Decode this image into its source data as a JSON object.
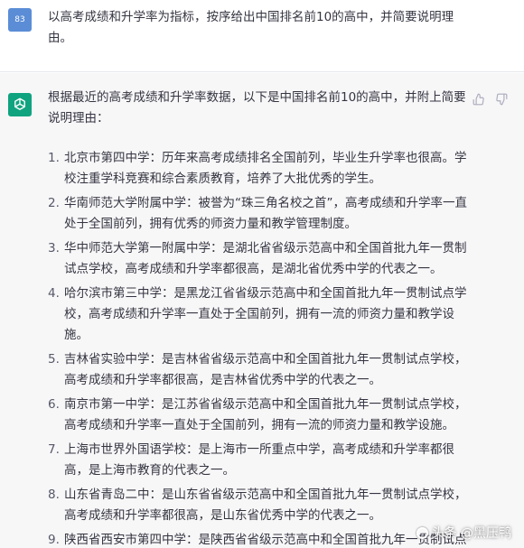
{
  "user": {
    "avatar_text": "83",
    "message": "以高考成绩和升学率为指标，按序给出中国排名前10的高中，并简要说明理由。"
  },
  "assistant": {
    "intro": "根据最近的高考成绩和升学率数据，以下是中国排名前10的高中，并附上简要说明理由：",
    "items": [
      {
        "num": "1.",
        "text": "北京市第四中学：历年来高考成绩排名全国前列，毕业生升学率也很高。学校注重学科竞赛和综合素质教育，培养了大批优秀的学生。"
      },
      {
        "num": "2.",
        "text": "华南师范大学附属中学：被誉为“珠三角名校之首”，高考成绩和升学率一直处于全国前列，拥有优秀的师资力量和教学管理制度。"
      },
      {
        "num": "3.",
        "text": "华中师范大学第一附属中学：是湖北省省级示范高中和全国首批九年一贯制试点学校，高考成绩和升学率都很高，是湖北省优秀中学的代表之一。"
      },
      {
        "num": "4.",
        "text": "哈尔滨市第三中学：是黑龙江省省级示范高中和全国首批九年一贯制试点学校，高考成绩和升学率一直处于全国前列，拥有一流的师资力量和教学设施。"
      },
      {
        "num": "5.",
        "text": "吉林省实验中学：是吉林省省级示范高中和全国首批九年一贯制试点学校，高考成绩和升学率都很高，是吉林省优秀中学的代表之一。"
      },
      {
        "num": "6.",
        "text": "南京市第一中学：是江苏省省级示范高中和全国首批九年一贯制试点学校，高考成绩和升学率一直处于全国前列，拥有一流的师资力量和教学设施。"
      },
      {
        "num": "7.",
        "text": "上海市世界外国语学校：是上海市一所重点中学，高考成绩和升学率都很高，是上海市教育的代表之一。"
      },
      {
        "num": "8.",
        "text": "山东省青岛二中：是山东省省级示范高中和全国首批九年一贯制试点学校，高考成绩和升学率都很高，是山东省优秀中学的代表之一。"
      },
      {
        "num": "9.",
        "text": "陕西省西安市第四中学：是陕西省省级示范高中和全国首批九年一贯制试点学校，高考成绩和升学率一直处于全国前列，培养了大批优秀的学生。"
      }
    ]
  },
  "watermark": {
    "text": "头条 @黑压鸭"
  },
  "colors": {
    "user_avatar": "#5b8dd6",
    "bot_avatar": "#10a37f",
    "bot_background": "#f7f7f8",
    "text": "#343541"
  },
  "icons": {
    "bot_avatar": "openai-logo-icon",
    "like": "thumbs-up-icon",
    "dislike": "thumbs-down-icon"
  }
}
